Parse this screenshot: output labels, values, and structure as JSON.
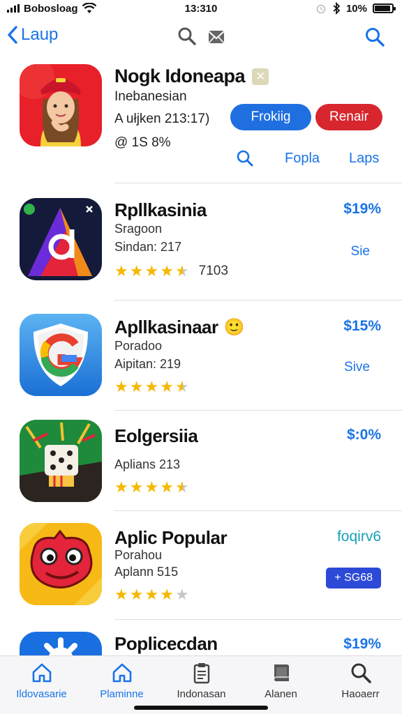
{
  "status_bar": {
    "carrier": "Bobosloag",
    "time": "13:310",
    "battery_percent": "10%",
    "battery_level": 0.9
  },
  "nav": {
    "back_label": "Laup",
    "icons": [
      "search-icon",
      "mail-icon",
      "search-icon"
    ]
  },
  "featured": {
    "title": "Nogk Idoneapa",
    "badge": "✕",
    "subtitle": "Inebanesian",
    "meta": "A ułjken 213:17)",
    "stat": "@ 1S 8%",
    "button_primary": "Frokiig",
    "button_secondary": "Renair",
    "link_1": "Fopla",
    "link_2": "Laps"
  },
  "apps": [
    {
      "title": "Rpllkasinia",
      "line1": "Sragoon",
      "line2": "Sindan: 217",
      "price": "$19%",
      "action": "Sie",
      "rating": 4.5,
      "rating_count": "7103",
      "icon": "d-logo-icon"
    },
    {
      "title": "Apllkasinaar",
      "title_emoji": "🙂",
      "line1": "Poradoo",
      "line2": "Aipitan: 219",
      "price": "$15%",
      "action": "Sive",
      "rating": 4.5,
      "icon": "shield-g-icon"
    },
    {
      "title": "Eolgersiia",
      "line1": "Aplians 213",
      "price": "$:0%",
      "rating": 4.5,
      "icon": "dice-game-icon"
    },
    {
      "title": "Aplic Popular",
      "line1": "Porahou",
      "line2": "Aplann 515",
      "price": "foqirv6",
      "price_pill": "+ SG68",
      "rating": 4,
      "icon": "red-monster-icon"
    },
    {
      "title": "Poplicecdan",
      "price": "$19%",
      "icon": "blue-gear-icon"
    }
  ],
  "tabs": [
    {
      "label": "Ildovasarie",
      "icon": "home-icon",
      "active": true
    },
    {
      "label": "Plaminne",
      "icon": "home-icon",
      "active": true
    },
    {
      "label": "Indonasan",
      "icon": "clipboard-icon",
      "active": false
    },
    {
      "label": "Alanen",
      "icon": "book-icon",
      "active": false
    },
    {
      "label": "Haoaerr",
      "icon": "search-icon",
      "active": false
    }
  ],
  "colors": {
    "accent": "#1a73e8",
    "button_red": "#d7262e",
    "star": "#f6b800",
    "pill": "#2c49d8"
  }
}
